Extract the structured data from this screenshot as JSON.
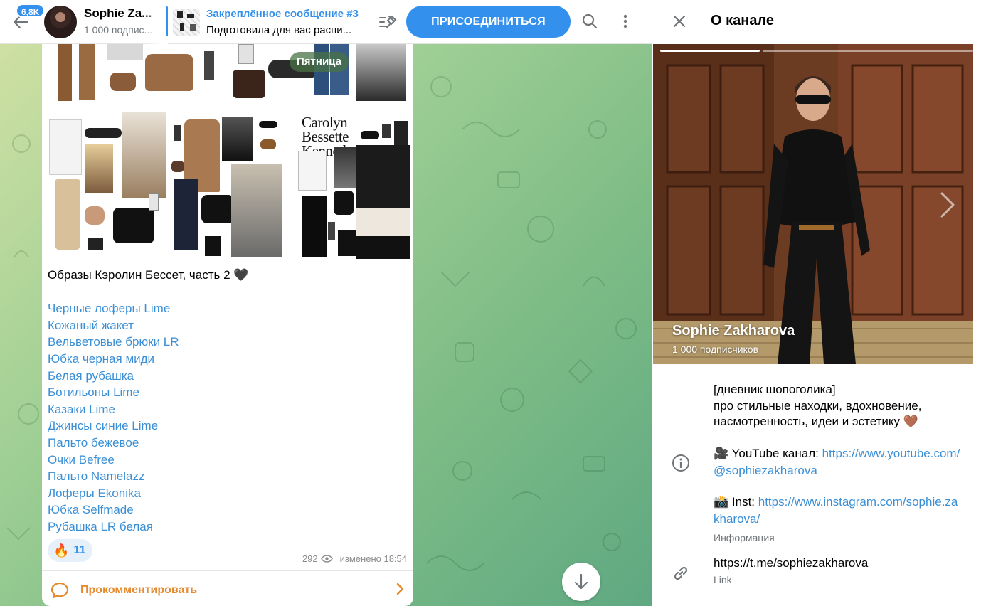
{
  "header": {
    "back_badge": "6,8K",
    "channel_title": "Sophie Za...",
    "subscribers": "1 000 подпис...",
    "pinned_title": "Закреплённое сообщение #3",
    "pinned_text": "Подготовила для вас распи...",
    "join_label": "ПРИСОЕДИНИТЬСЯ"
  },
  "message": {
    "day_label": "Пятница",
    "collage_text": "Carolyn Bessette Kennedy",
    "caption": "Образы Кэролин Бессет, часть 2 🖤",
    "links": [
      "Черные лоферы Lime",
      "Кожаный жакет",
      "Вельветовые брюки LR",
      "Юбка черная миди",
      "Белая рубашка",
      "Ботильоны Lime",
      "Казаки Lime",
      "Джинсы синие Lime",
      "Пальто бежевое",
      "Очки Befree",
      "Пальто Namelazz",
      "Лоферы Ekonika",
      "Юбка Selfmade",
      "Рубашка LR белая"
    ],
    "reaction_emoji": "🔥",
    "reaction_count": "11",
    "views": "292",
    "edited": "изменено 18:54",
    "comment_label": "Прокомментировать"
  },
  "panel": {
    "title": "О канале",
    "cover_name": "Sophie Zakharova",
    "cover_subs": "1 000 подписчиков",
    "description": [
      "[дневник шопоголика]",
      "про стильные находки, вдохновение,",
      "насмотренность, идеи и эстетику 🤎"
    ],
    "youtube_prefix": "🎥 YouTube канал: ",
    "youtube_url": "https://www.youtube.com/@sophiezakharova",
    "inst_prefix": "📸 Inst: ",
    "inst_url": "https://www.instagram.com/sophie.zakharova/",
    "info_label": "Информация",
    "link_url": "https://t.me/sophiezakharova",
    "link_label": "Link"
  }
}
